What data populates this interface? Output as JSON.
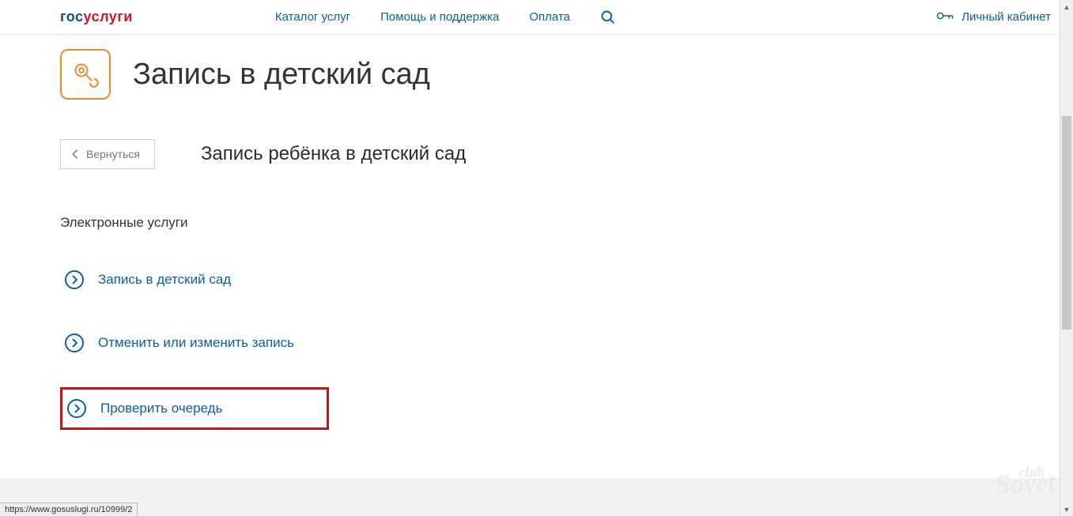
{
  "logo": {
    "part1": "гос",
    "part2": "услуги"
  },
  "nav": {
    "catalog": "Каталог услуг",
    "help": "Помощь и поддержка",
    "pay": "Оплата"
  },
  "account": {
    "label": "Личный кабинет"
  },
  "page": {
    "title": "Запись в детский сад",
    "back": "Вернуться",
    "subtitle": "Запись ребёнка в детский сад",
    "section": "Электронные услуги"
  },
  "services": [
    {
      "label": "Запись в детский сад"
    },
    {
      "label": "Отменить или изменить запись"
    },
    {
      "label": "Проверить очередь"
    }
  ],
  "status_url": "https://www.gosuslugi.ru/10999/2",
  "watermark": {
    "small": "club",
    "big": "Sovet"
  }
}
